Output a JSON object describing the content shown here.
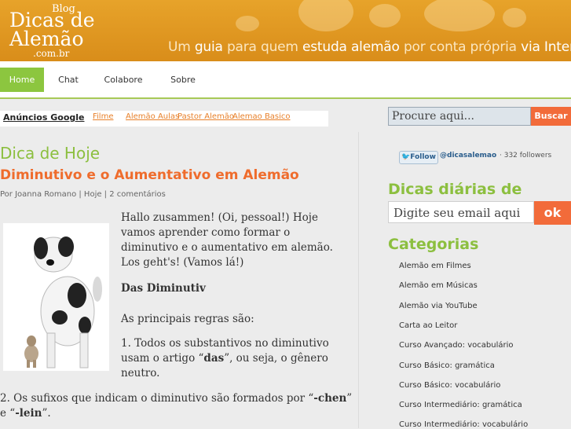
{
  "header": {
    "logo_blog": "Blog",
    "logo_line1": "Dicas de",
    "logo_line2": "Alemão",
    "logo_com": ".com.br",
    "tagline_parts": [
      "Um",
      "guia",
      "para quem",
      "estuda alemão",
      "por conta própria",
      "via Internet"
    ]
  },
  "nav": {
    "items": [
      "Home",
      "Chat",
      "Colabore",
      "Sobre"
    ]
  },
  "ads": {
    "title": "Anúncios Google",
    "links": [
      "Filme",
      "Alemão Aulas",
      "Pastor Alemão",
      "Alemao Basico"
    ]
  },
  "search": {
    "placeholder": "Procure aqui...",
    "button": "Buscar"
  },
  "main": {
    "section_title": "Dica de Hoje",
    "post_title": "Diminutivo e o Aumentativo em Alemão",
    "byline": "Por Joanna Romano | Hoje | 2 comentários",
    "intro": "Hallo zusammen! (Oi, pessoal!) Hoje vamos aprender como formar o diminutivo e o aumentativo em alemão. Los geht's! (Vamos lá!)",
    "subheading": "Das Diminutiv",
    "rules_intro": "As principais regras são:",
    "rule1_a": "1. Todos os substantivos no diminutivo usam o artigo “",
    "rule1_b": "das",
    "rule1_c": "”, ou seja, o gênero neutro.",
    "rule2_a": "2. Os sufixos que indicam o diminutivo são formados por “",
    "rule2_b": "-chen",
    "rule2_c": "” e “",
    "rule2_d": "-lein",
    "rule2_e": "”."
  },
  "sidebar": {
    "follow_label": "Follow",
    "follow_handle": "@dicasalemao",
    "follow_count": "· 332 followers",
    "daily_title": "Dicas diárias de",
    "email_placeholder": "Digite seu email aqui",
    "email_button": "ok",
    "categories_title": "Categorias",
    "categories": [
      "Alemão em Filmes",
      "Alemão em Músicas",
      "Alemão via YouTube",
      "Carta ao Leitor",
      "Curso Avançado: vocabulário",
      "Curso Básico: gramática",
      "Curso Básico: vocabulário",
      "Curso Intermediário: gramática",
      "Curso Intermediário: vocabulário"
    ]
  },
  "colors": {
    "header_orange": "#de951f",
    "accent_green": "#8cc63f",
    "title_orange": "#ef6c2c",
    "button_orange": "#f26b3a"
  }
}
